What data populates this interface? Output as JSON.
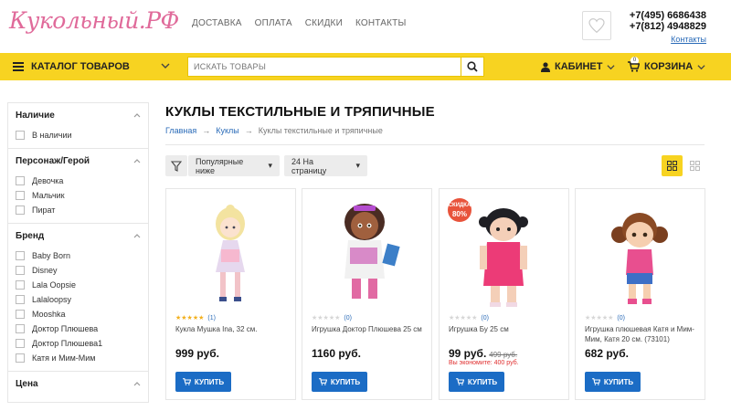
{
  "header": {
    "logo": "Кукольный.РФ",
    "links": [
      "ДОСТАВКА",
      "ОПЛАТА",
      "СКИДКИ",
      "КОНТАКТЫ"
    ],
    "phone1": "+7(495) 6686438",
    "phone2": "+7(812) 4948829",
    "contacts_link": "Контакты"
  },
  "nav": {
    "catalog": "КАТАЛОГ ТОВАРОВ",
    "search_placeholder": "ИСКАТЬ ТОВАРЫ",
    "cabinet": "КАБИНЕТ",
    "cart": "КОРЗИНА",
    "cart_count": "0"
  },
  "filters": [
    {
      "title": "Наличие",
      "items": [
        "В наличии"
      ]
    },
    {
      "title": "Персонаж/Герой",
      "items": [
        "Девочка",
        "Мальчик",
        "Пират"
      ]
    },
    {
      "title": "Бренд",
      "items": [
        "Baby Born",
        "Disney",
        "Lala Oopsie",
        "Lalaloopsy",
        "Mooshka",
        "Доктор Плюшева",
        "Доктор Плюшева1",
        "Катя и Мим-Мим"
      ]
    },
    {
      "title": "Цена",
      "items": []
    }
  ],
  "page": {
    "title": "КУКЛЫ ТЕКСТИЛЬНЫЕ И ТРЯПИЧНЫЕ",
    "breadcrumbs": [
      "Главная",
      "Куклы",
      "Куклы текстильные и тряпичные"
    ],
    "sort_label": "Популярные ниже",
    "perpage_label": "24 На страницу"
  },
  "products": [
    {
      "name": "Кукла Мушка Ina, 32 см.",
      "price": "999 руб.",
      "rating": "(1)",
      "stars": 5,
      "buy": "КУПИТЬ"
    },
    {
      "name": "Игрушка Доктор Плюшева 25 см",
      "price": "1160 руб.",
      "rating": "(0)",
      "stars": 0,
      "buy": "КУПИТЬ"
    },
    {
      "name": "Игрушка Бу 25 см",
      "price": "99 руб.",
      "old_price": "499 руб.",
      "savings": "Вы экономите: 400 руб.",
      "sale_badge": "СКИДКА",
      "sale_pct": "80%",
      "rating": "(0)",
      "stars": 0,
      "buy": "КУПИТЬ"
    },
    {
      "name": "Игрушка плюшевая Катя и Мим-Мим, Катя 20 см. (73101)",
      "price": "682 руб.",
      "rating": "(0)",
      "stars": 0,
      "buy": "КУПИТЬ"
    }
  ],
  "colors": {
    "accent": "#f7d321",
    "button": "#1b6cc5",
    "link": "#2a6bb8",
    "sale": "#e8533b"
  }
}
